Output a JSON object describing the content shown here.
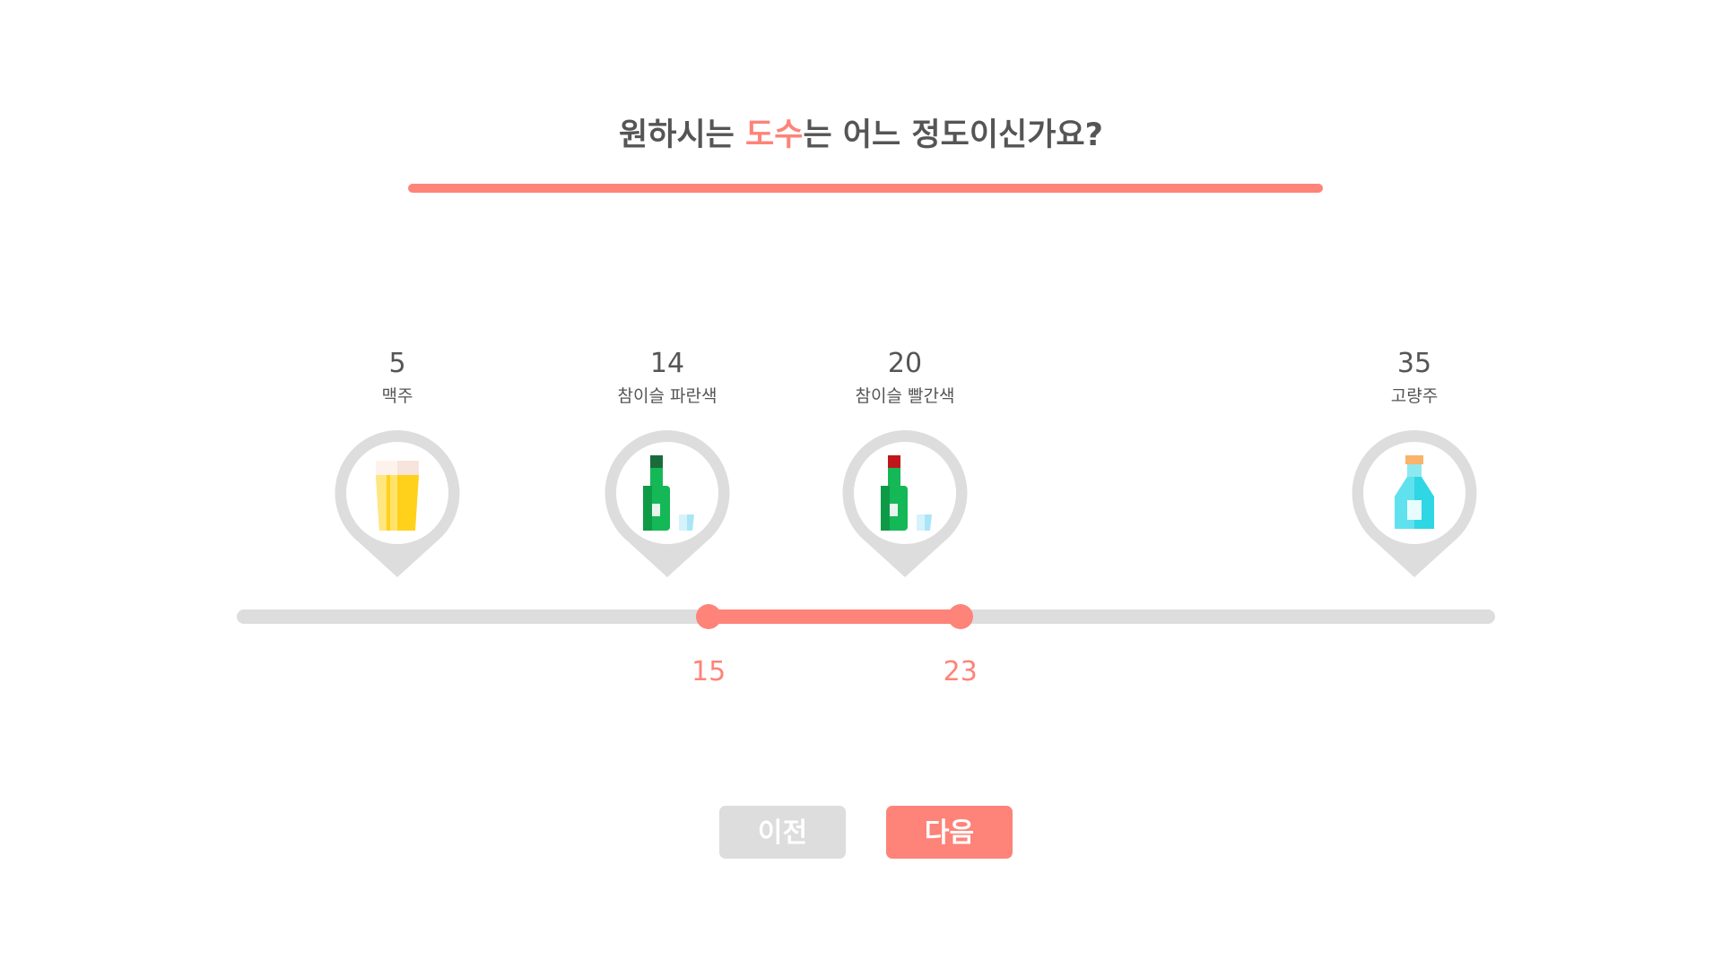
{
  "question": {
    "prefix": "원하시는 ",
    "highlight": "도수",
    "suffix": "는 어느 정도이신가요?"
  },
  "progress": {
    "value": 1.0
  },
  "slider": {
    "min": 0,
    "max": 40,
    "range_low": 15,
    "range_high": 23,
    "low_label": "15",
    "high_label": "23"
  },
  "markers": [
    {
      "value": "5",
      "label": "맥주",
      "abv": 5,
      "icon": "beer-glass-icon"
    },
    {
      "value": "14",
      "label": "참이슬 파란색",
      "abv": 14,
      "icon": "soju-bottle-green-cap-icon"
    },
    {
      "value": "20",
      "label": "참이슬 빨간색",
      "abv": 20,
      "icon": "soju-bottle-red-cap-icon"
    },
    {
      "value": "35",
      "label": "고량주",
      "abv": 35,
      "icon": "liquor-bottle-icon"
    }
  ],
  "buttons": {
    "prev_label": "이전",
    "next_label": "다음"
  },
  "colors": {
    "accent": "#fe8379",
    "track": "#dddddd",
    "text": "#555555",
    "pin": "#dddddd"
  }
}
